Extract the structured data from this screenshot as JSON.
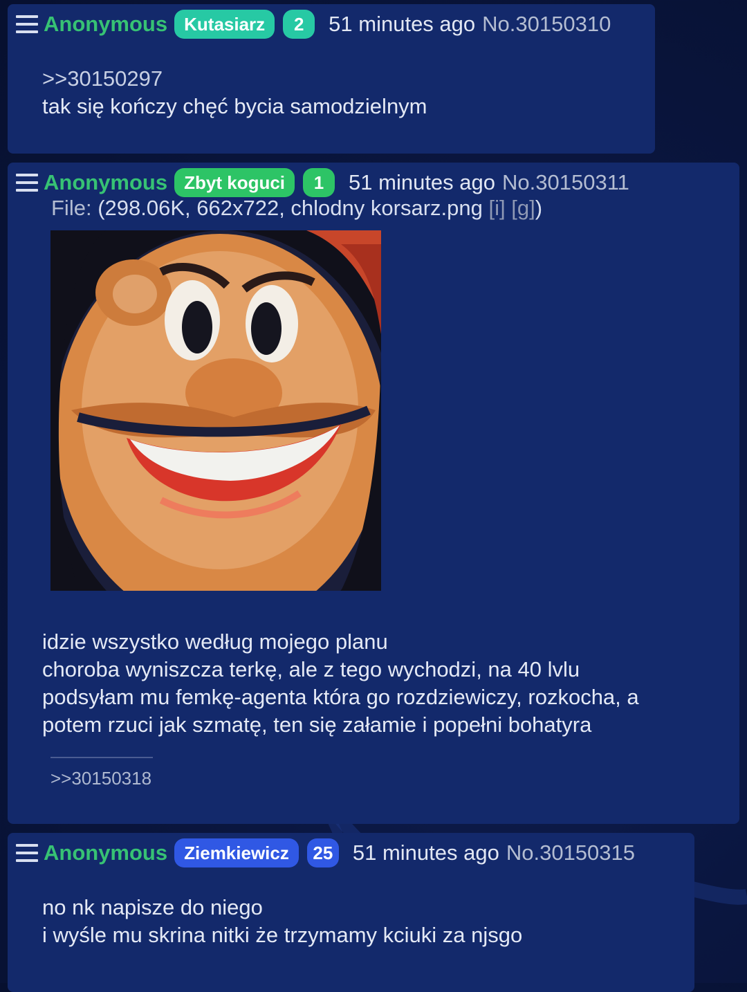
{
  "posts": [
    {
      "name": "Anonymous",
      "flag": "Kutasiarz",
      "count": "2",
      "time": "51 minutes ago",
      "number": "No.30150310",
      "body": [
        ">>30150297",
        "tak się kończy chęć bycia samodzielnym"
      ]
    },
    {
      "name": "Anonymous",
      "flag": "Zbyt koguci",
      "count": "1",
      "time": "51 minutes ago",
      "number": "No.30150311",
      "file": {
        "label": "File:",
        "open": "(",
        "details": "298.06K, 662x722, chlodny korsarz.png",
        "i_link": "[i]",
        "g_link": "[g]",
        "close": ")"
      },
      "body": [
        "idzie wszystko według mojego planu",
        "choroba wyniszcza terkę, ale z tego wychodzi, na 40 lvlu",
        "podsyłam mu femkę-agenta która go rozdziewiczy, rozkocha, a",
        "potem rzuci jak szmatę, ten się załamie i popełni bohatyra"
      ],
      "replies": [
        ">>30150318"
      ]
    },
    {
      "name": "Anonymous",
      "flag": "Ziemkiewicz",
      "count": "25",
      "time": "51 minutes ago",
      "number": "No.30150315",
      "body": [
        "no nk napisze do niego",
        "i wyśle mu skrina nitki że trzymamy kciuki za njsgo"
      ]
    }
  ],
  "colors": {
    "name": "#37c274",
    "badge_teal": "#27c9a4",
    "badge_green": "#2dc466",
    "badge_blue": "#3058e4",
    "post_bg": "#13296b",
    "page_bg": "#0a1640"
  },
  "icons": {
    "post_menu": "hamburger-menu-icon"
  }
}
